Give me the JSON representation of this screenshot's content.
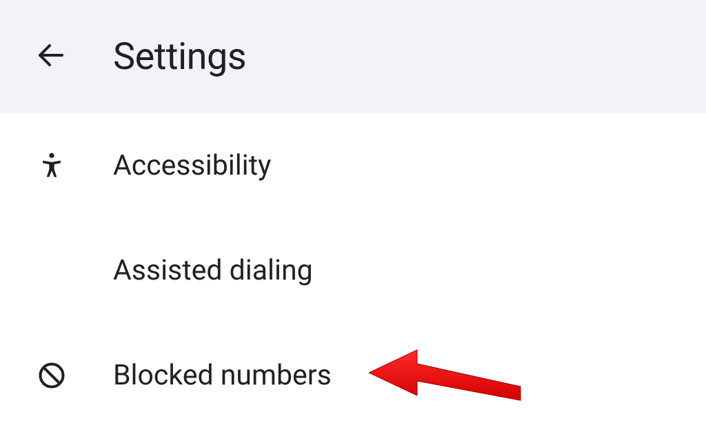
{
  "header": {
    "title": "Settings"
  },
  "items": [
    {
      "label": "Accessibility",
      "icon": "accessibility-icon"
    },
    {
      "label": "Assisted dialing",
      "icon": null
    },
    {
      "label": "Blocked numbers",
      "icon": "block-icon"
    }
  ],
  "annotation": {
    "arrow_color": "#ff0000",
    "points_to_item_index": 2
  }
}
